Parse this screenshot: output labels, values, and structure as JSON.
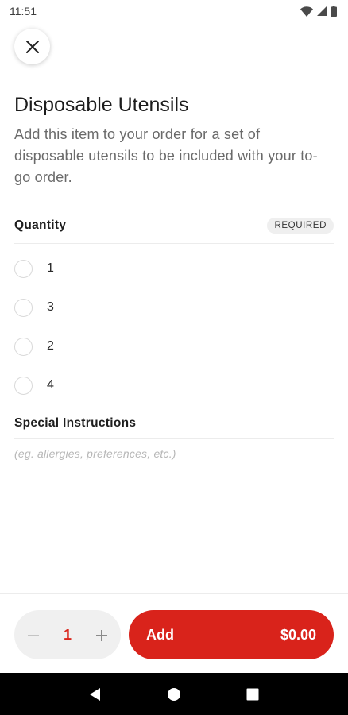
{
  "status_bar": {
    "time": "11:51"
  },
  "header": {
    "close_icon": "close-icon"
  },
  "item": {
    "title": "Disposable Utensils",
    "description": "Add this item to your order for a set of disposable utensils to be included with your to-go order."
  },
  "quantity_section": {
    "title": "Quantity",
    "badge": "REQUIRED",
    "options": [
      {
        "label": "1",
        "selected": false
      },
      {
        "label": "3",
        "selected": false
      },
      {
        "label": "2",
        "selected": false
      },
      {
        "label": "4",
        "selected": false
      }
    ]
  },
  "instructions_section": {
    "title": "Special Instructions",
    "placeholder": "(eg. allergies, preferences, etc.)"
  },
  "footer": {
    "quantity": "1",
    "minus_icon": "minus-icon",
    "plus_icon": "plus-icon",
    "add_label": "Add",
    "price": "$0.00"
  },
  "colors": {
    "accent": "#d9231b",
    "quantity_text": "#d9261c",
    "nav_bar": "#000000"
  },
  "system_nav": {
    "back_icon": "back-triangle-icon",
    "home_icon": "home-circle-icon",
    "recents_icon": "recents-square-icon"
  }
}
